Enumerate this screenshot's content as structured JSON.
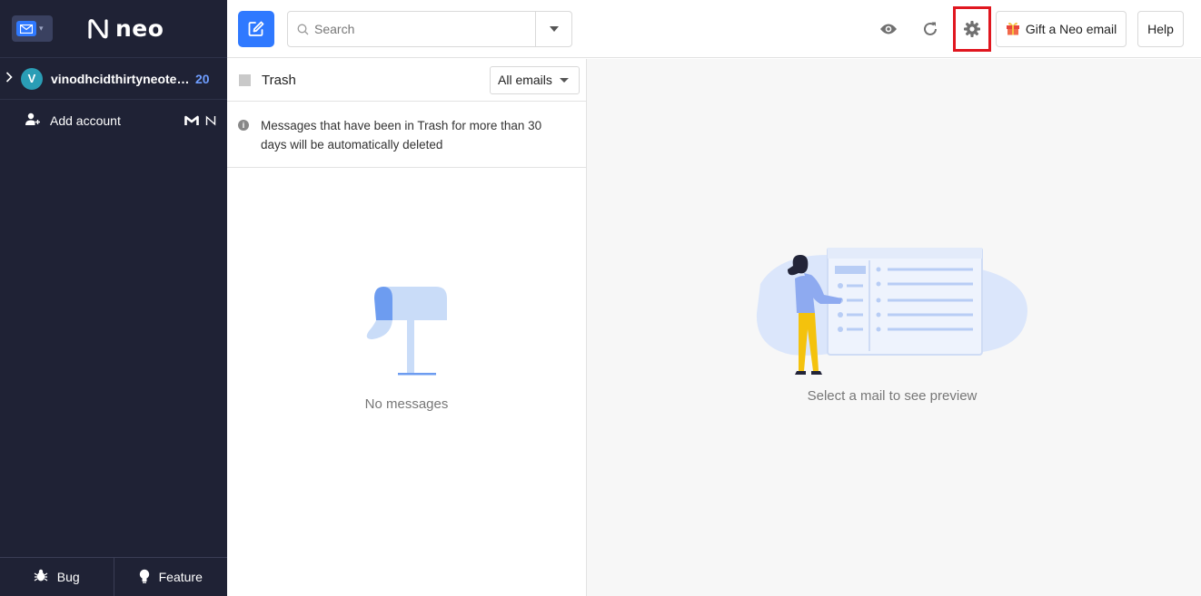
{
  "sidebar": {
    "logo_text": "neo",
    "account": {
      "avatar_letter": "V",
      "name": "vinodhcidthirtyneotest...",
      "unread_count": "20"
    },
    "add_account_label": "Add account",
    "footer": {
      "bug_label": "Bug",
      "feature_label": "Feature"
    }
  },
  "toolbar": {
    "search_placeholder": "Search",
    "gift_label": "Gift a Neo email",
    "help_label": "Help",
    "icons": [
      "compose-icon",
      "search-icon",
      "chevron-down-icon",
      "eye-icon",
      "refresh-icon",
      "gear-icon",
      "gift-icon"
    ]
  },
  "list": {
    "folder_title": "Trash",
    "filter_value": "All emails",
    "notice": "Messages that have been in Trash for more than 30 days will be automatically deleted",
    "empty_text": "No messages"
  },
  "preview": {
    "empty_text": "Select a mail to see preview"
  },
  "colors": {
    "sidebar_bg": "#1f2235",
    "accent": "#2f79ff",
    "highlight_box": "#e0161f",
    "avatar": "#2a9db5"
  }
}
